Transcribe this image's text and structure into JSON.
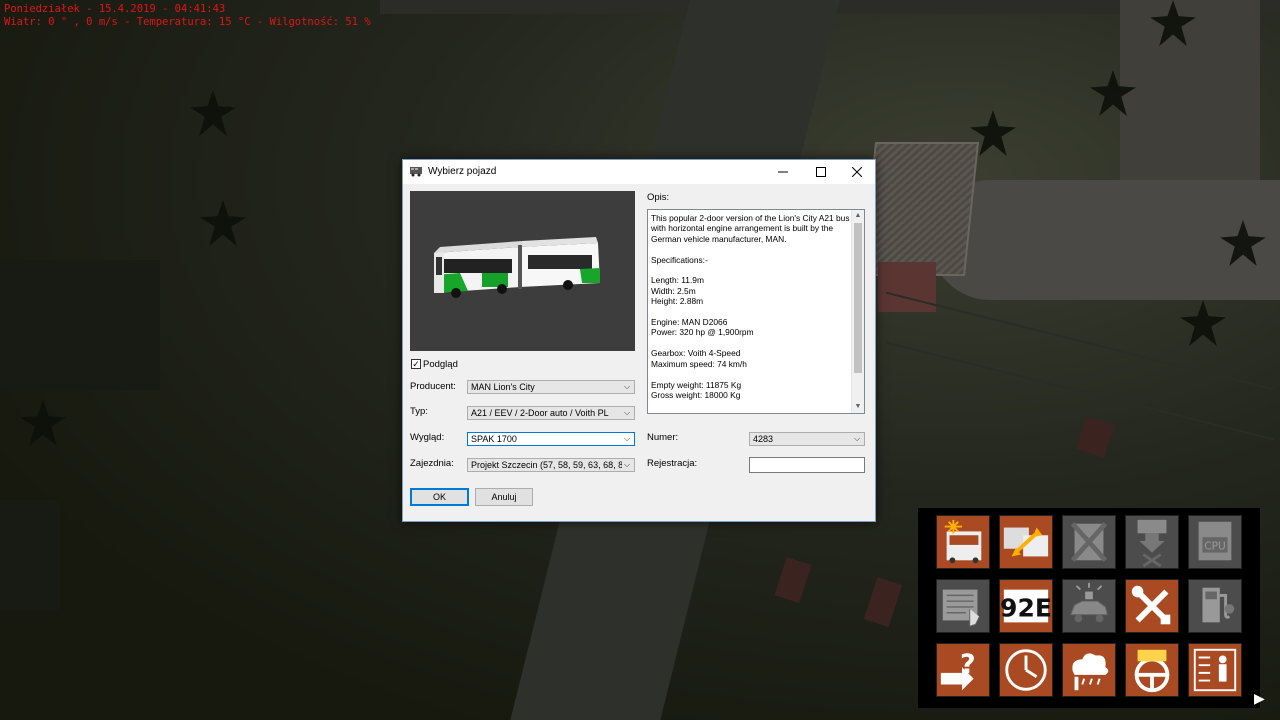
{
  "hud": {
    "line1": "Poniedziałek - 15.4.2019 - 04:41:43",
    "line2": "Wiatr: 0 ° , 0 m/s - Temperatura: 15 °C - Wilgotność: 51 %"
  },
  "dialog": {
    "title": "Wybierz pojazd",
    "app_icon": "bus-icon",
    "preview_label": "Podgląd",
    "preview_checked": true,
    "fields": {
      "producent": {
        "label": "Producent:",
        "value": "MAN Lion's City"
      },
      "typ": {
        "label": "Typ:",
        "value": "A21 / EEV / 2-Door auto / Voith PL"
      },
      "wyglad": {
        "label": "Wygląd:",
        "value": "SPAK 1700"
      },
      "zajezdnia": {
        "label": "Zajezdnia:",
        "value": "Projekt Szczecin (57, 58, 59, 63, 68, 8"
      },
      "numer": {
        "label": "Numer:",
        "value": "4283"
      },
      "rejestracja": {
        "label": "Rejestracja:",
        "value": ""
      }
    },
    "description_label": "Opis:",
    "description": "This popular 2-door version of the Lion's City A21 bus with horizontal engine arrangement is built by the German vehicle manufacturer, MAN.\n\nSpecifications:-\n\nLength: 11.9m\nWidth: 2.5m\nHeight: 2.88m\n\nEngine: MAN D2066\nPower: 320 hp @ 1,900rpm\n\nGearbox: Voith 4-Speed\nMaximum speed: 74 km/h\n\nEmpty weight: 11875 Kg\nGross weight: 18000 Kg",
    "ok_label": "OK",
    "cancel_label": "Anuluj"
  },
  "tools": [
    {
      "icon": "bus-light-icon",
      "style": "orange"
    },
    {
      "icon": "bus-swap-icon",
      "style": "orange"
    },
    {
      "icon": "remove-bus-icon",
      "style": "gray"
    },
    {
      "icon": "place-bus-icon",
      "style": "gray"
    },
    {
      "icon": "bus-cpu-icon",
      "style": "gray"
    },
    {
      "icon": "timetable-icon",
      "style": "gray"
    },
    {
      "icon": "route-display-icon",
      "style": "orange"
    },
    {
      "icon": "car-alarm-icon",
      "style": "gray"
    },
    {
      "icon": "repair-tools-icon",
      "style": "orange"
    },
    {
      "icon": "fuel-pump-icon",
      "style": "gray"
    },
    {
      "icon": "help-exit-icon",
      "style": "orange"
    },
    {
      "icon": "clock-icon",
      "style": "orange"
    },
    {
      "icon": "weather-icon",
      "style": "orange"
    },
    {
      "icon": "steering-wheel-icon",
      "style": "orange"
    },
    {
      "icon": "checklist-driver-icon",
      "style": "orange"
    }
  ],
  "colors": {
    "hud_text": "#e01515",
    "accent": "#0078d7",
    "tool_orange": "#a94a22",
    "tool_gray": "#4c4c4c"
  }
}
